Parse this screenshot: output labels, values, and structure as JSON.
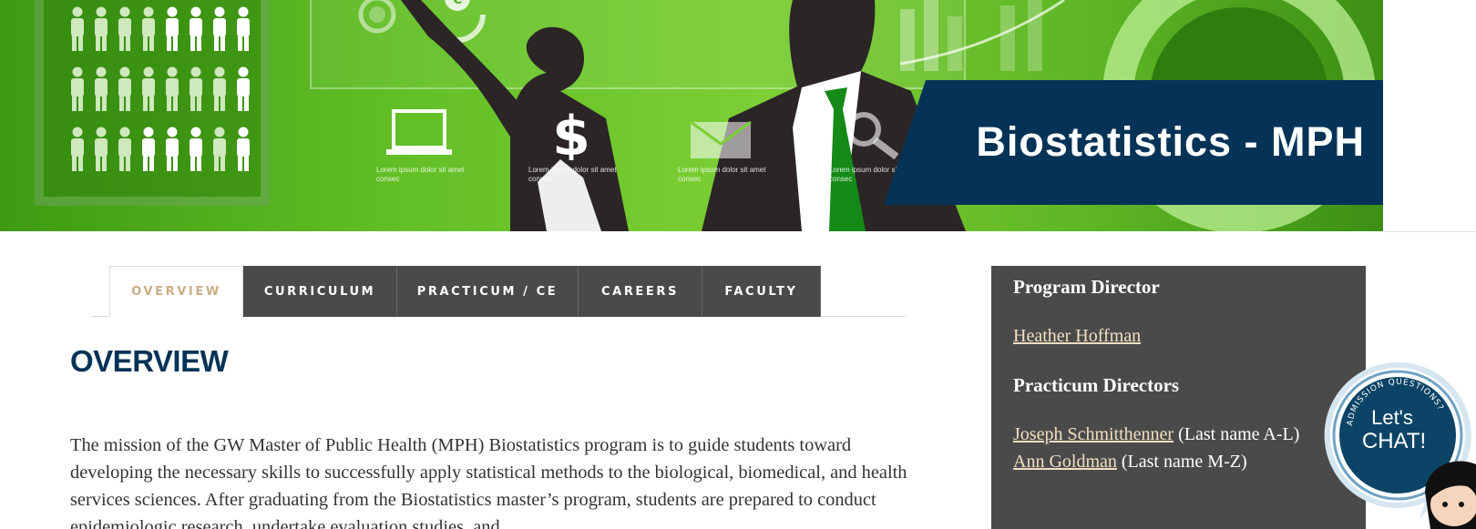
{
  "hero": {
    "title": "Biostatistics - MPH",
    "features": [
      {
        "icon": "laptop-icon",
        "caption": "Lorem ipsum dolor sit amet consec"
      },
      {
        "icon": "dollar-icon",
        "caption": "Lorem ipsum dolor sit amet consec"
      },
      {
        "icon": "envelope-icon",
        "caption": "Lorem ipsum dolor sit amet consec"
      },
      {
        "icon": "magnifier-icon",
        "caption": "Lorem ipsum dolor sit amet consec"
      }
    ],
    "colors": {
      "banner": "#053357",
      "green": "#63c026"
    }
  },
  "tabs": [
    {
      "label": "OVERVIEW",
      "active": true
    },
    {
      "label": "CURRICULUM",
      "active": false
    },
    {
      "label": "PRACTICUM / CE",
      "active": false
    },
    {
      "label": "CAREERS",
      "active": false
    },
    {
      "label": "FACULTY",
      "active": false
    }
  ],
  "main": {
    "heading": "OVERVIEW",
    "body": "The mission of the GW Master of Public Health (MPH) Biostatistics program is to guide students toward developing the necessary skills to successfully apply statistical methods to the biological, biomedical, and health services sciences. After graduating from the Biostatistics master’s program, students are prepared to conduct epidemiologic research, undertake evaluation studies, and"
  },
  "sidebar": {
    "director_heading": "Program Director",
    "director_name": "Heather Hoffman",
    "practicum_heading": "Practicum Directors",
    "practicum_1_name": "Joseph Schmitthenner",
    "practicum_1_note": "(Last name A-L)",
    "practicum_2_name": "Ann Goldman",
    "practicum_2_note": "(Last name M-Z)"
  },
  "chat": {
    "arc_text": "ADMISSION QUESTIONS?",
    "line1": "Let's",
    "line2": "CHAT!",
    "colors": {
      "bubble": "#0b4466",
      "ring": "#6fa2c4"
    }
  },
  "colors": {
    "accent_link": "#f3dfc2",
    "heading": "#053357",
    "tab_bg": "#4a4a4a",
    "active_tab_text": "#c9ad85"
  }
}
